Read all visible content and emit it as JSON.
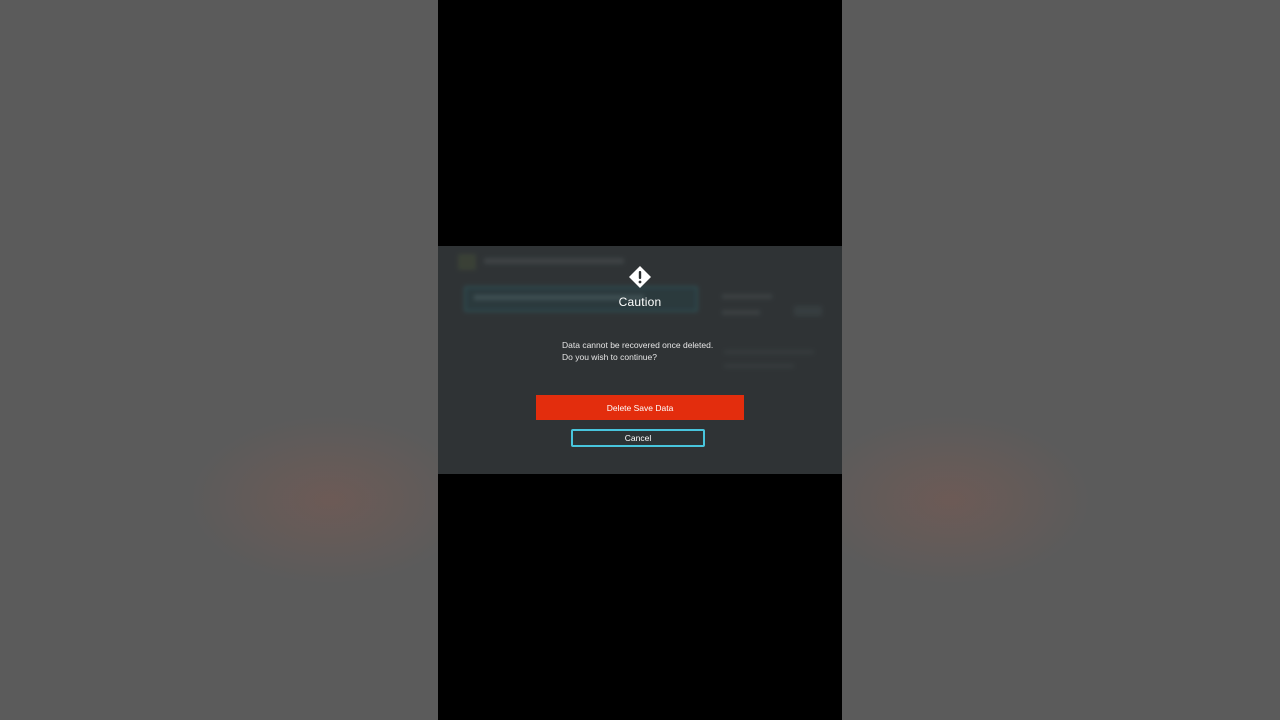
{
  "dialog": {
    "icon": "caution-diamond-icon",
    "title": "Caution",
    "message_line1": "Data cannot be recovered once deleted.",
    "message_line2": "Do you wish to continue?",
    "delete_label": "Delete Save Data",
    "cancel_label": "Cancel"
  },
  "colors": {
    "delete_button": "#e32d0d",
    "focus_outline": "#48c6dd",
    "dialog_background": "#3f4446",
    "letterbox": "#000000",
    "outer_background": "#5b5b5b"
  }
}
